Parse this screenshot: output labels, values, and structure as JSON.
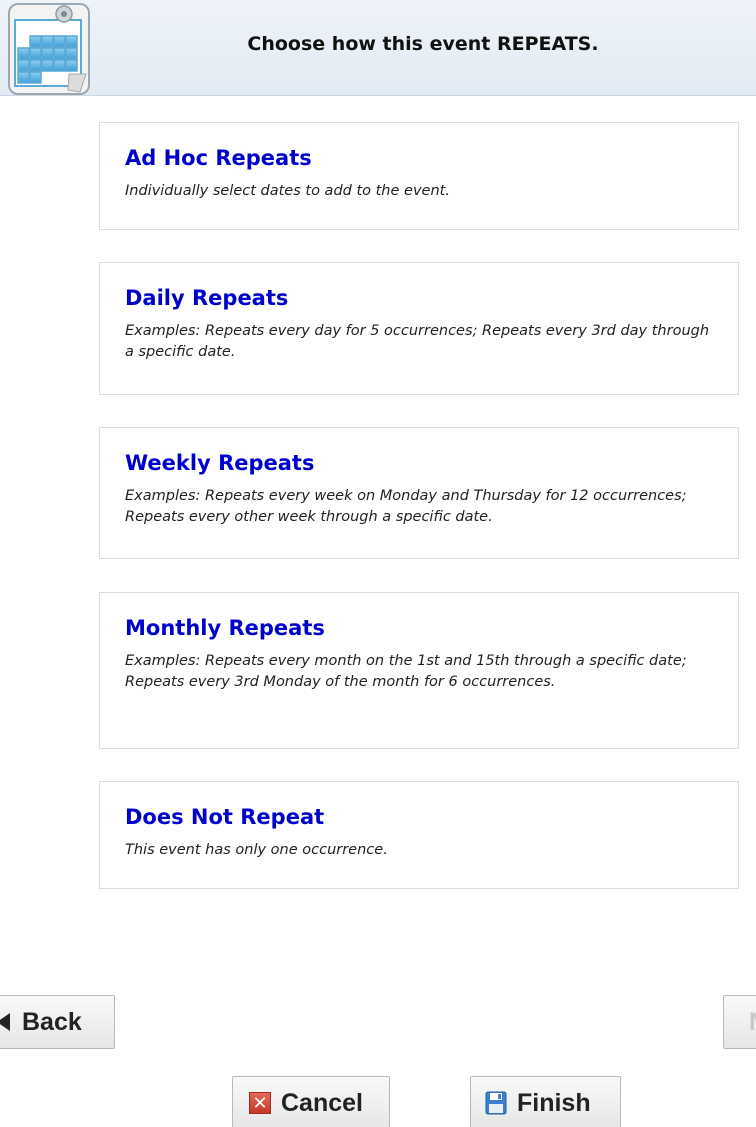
{
  "header": {
    "title": "Choose how this event REPEATS."
  },
  "options": [
    {
      "title": "Ad Hoc Repeats",
      "description": "Individually select dates to add to the event."
    },
    {
      "title": "Daily Repeats",
      "description": "Examples: Repeats every day for 5 occurrences; Repeats every 3rd day through a specific date."
    },
    {
      "title": "Weekly Repeats",
      "description": "Examples: Repeats every week on Monday and Thursday for 12 occurrences; Repeats every other week through a specific date."
    },
    {
      "title": "Monthly Repeats",
      "description": "Examples: Repeats every month on the 1st and 15th through a specific date; Repeats every 3rd Monday of the month for 6 occurrences."
    },
    {
      "title": "Does Not Repeat",
      "description": "This event has only one occurrence."
    }
  ],
  "buttons": {
    "back": "Back",
    "next": "N",
    "cancel": "Cancel",
    "finish": "Finish"
  },
  "icons": {
    "header": "calendar-icon",
    "back": "left-arrow-icon",
    "cancel": "close-x-icon",
    "finish": "floppy-disk-icon"
  },
  "colors": {
    "option_title": "#0000cc",
    "header_bg": "#e6eef5",
    "next_disabled": "#c7c7c7"
  }
}
